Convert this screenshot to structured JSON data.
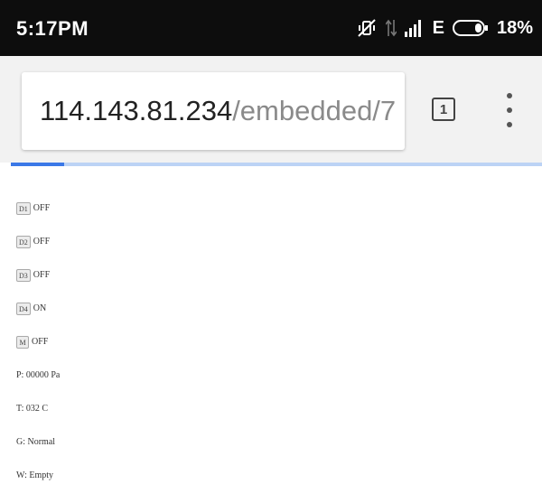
{
  "status_bar": {
    "time": "5:17PM",
    "network": "E",
    "battery": "18%"
  },
  "browser": {
    "url_host": "114.143.81.234",
    "url_path": "/embedded/7",
    "tab_count": "1",
    "load_progress": 0.1
  },
  "devices": [
    {
      "label": "D1",
      "state": "OFF"
    },
    {
      "label": "D2",
      "state": "OFF"
    },
    {
      "label": "D3",
      "state": "OFF"
    },
    {
      "label": "D4",
      "state": "ON"
    },
    {
      "label": "M",
      "state": "OFF"
    }
  ],
  "readings": {
    "pressure": "P: 00000 Pa",
    "temperature": "T: 032 C",
    "gas": "G: Normal",
    "water": "W: Empty"
  }
}
